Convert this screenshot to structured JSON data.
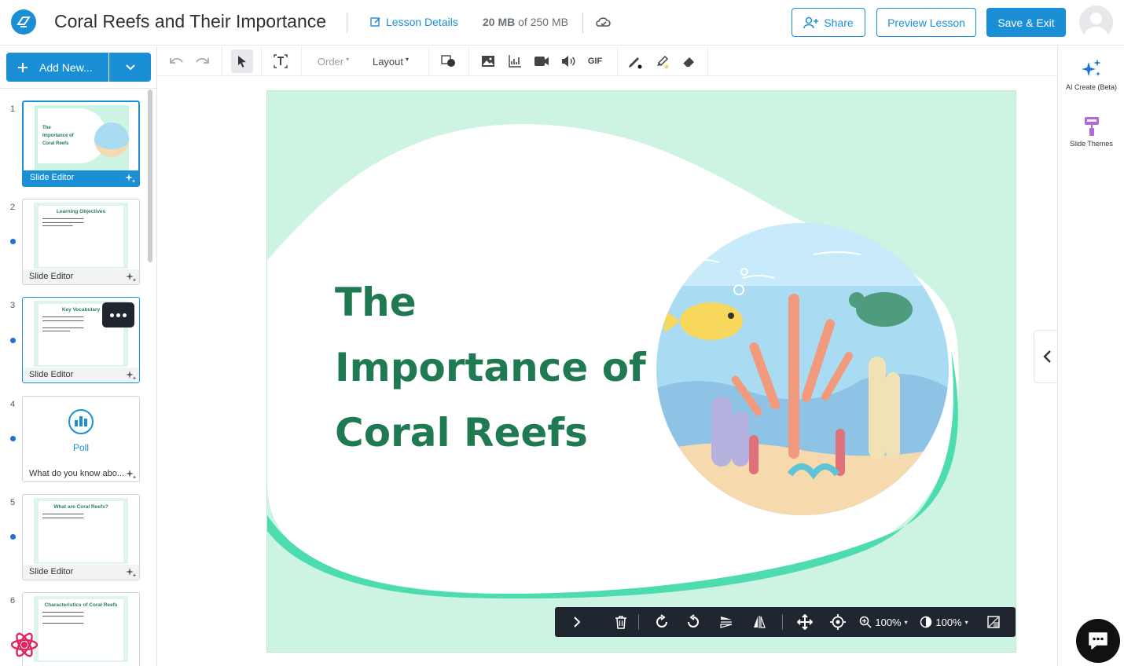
{
  "header": {
    "title": "Coral Reefs and Their Importance",
    "lesson_details": "Lesson Details",
    "storage_used": "20 MB",
    "storage_of": "of 250 MB",
    "share": "Share",
    "preview": "Preview Lesson",
    "save_exit": "Save & Exit"
  },
  "sidebar": {
    "add_new": "Add New...",
    "slides": [
      {
        "num": "1",
        "caption": "Slide Editor",
        "mini_title_lines": [
          "The",
          "Importance of",
          "Coral Reefs"
        ]
      },
      {
        "num": "2",
        "caption": "Slide Editor",
        "mini_title": "Learning Objectives"
      },
      {
        "num": "3",
        "caption": "Slide Editor",
        "mini_title": "Key Vocabulary"
      },
      {
        "num": "4",
        "caption": "What do you know abo...",
        "poll_label": "Poll"
      },
      {
        "num": "5",
        "caption": "Slide Editor",
        "mini_title": "What are Coral Reefs?"
      },
      {
        "num": "6",
        "caption": "",
        "mini_title": "Characteristics of Coral Reefs"
      }
    ]
  },
  "toolbar": {
    "order": "Order",
    "layout": "Layout",
    "gif": "GIF"
  },
  "slide": {
    "title_lines": [
      "The",
      "Importance of",
      "Coral Reefs"
    ]
  },
  "float_bar": {
    "zoom": "100%",
    "opacity": "100%"
  },
  "right_panel": {
    "ai_create": "AI Create (Beta)",
    "slide_themes": "Slide Themes"
  },
  "colors": {
    "accent": "#1a8fd6",
    "slide_bg": "#cdf3e3",
    "title_green": "#1f7a52",
    "wave": "#4ddbb0"
  }
}
